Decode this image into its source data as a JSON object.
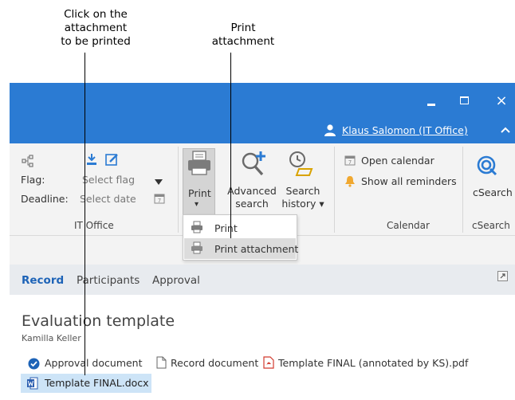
{
  "callouts": {
    "left": [
      "Click on the",
      "attachment",
      "to be printed"
    ],
    "right": [
      "Print",
      "attachment"
    ]
  },
  "window": {
    "minimize_icon": "minimize-icon",
    "maximize_icon": "maximize-icon",
    "close_label": "×"
  },
  "user": {
    "name": "Klaus Salomon (IT Office)"
  },
  "ribbon": {
    "it_office": {
      "flag_label": "Flag:",
      "flag_value": "Select flag",
      "deadline_label": "Deadline:",
      "deadline_value": "Select date",
      "group_label": "IT Office"
    },
    "print": {
      "label": "Print",
      "arrow": "▾"
    },
    "advanced_search": {
      "line1": "Advanced",
      "line2": "search"
    },
    "search_history": {
      "line1": "Search",
      "line2": "history ▾"
    },
    "calendar": {
      "open_label": "Open calendar",
      "reminders_label": "Show all reminders",
      "group_label": "Calendar"
    },
    "csearch": {
      "label": "cSearch",
      "group_label": "cSearch"
    }
  },
  "print_menu": {
    "items": [
      "Print",
      "Print attachment"
    ]
  },
  "tabs": [
    "Record",
    "Participants",
    "Approval"
  ],
  "document": {
    "title": "Evaluation template",
    "author": "Kamilla Keller",
    "attachments": [
      "Approval document",
      "Record document",
      "Template FINAL (annotated by KS).pdf"
    ],
    "selected_file": "Template FINAL.docx"
  },
  "colors": {
    "accent": "#2b7bd3",
    "tab_active": "#1d63b7",
    "selection": "#cde4f7"
  }
}
